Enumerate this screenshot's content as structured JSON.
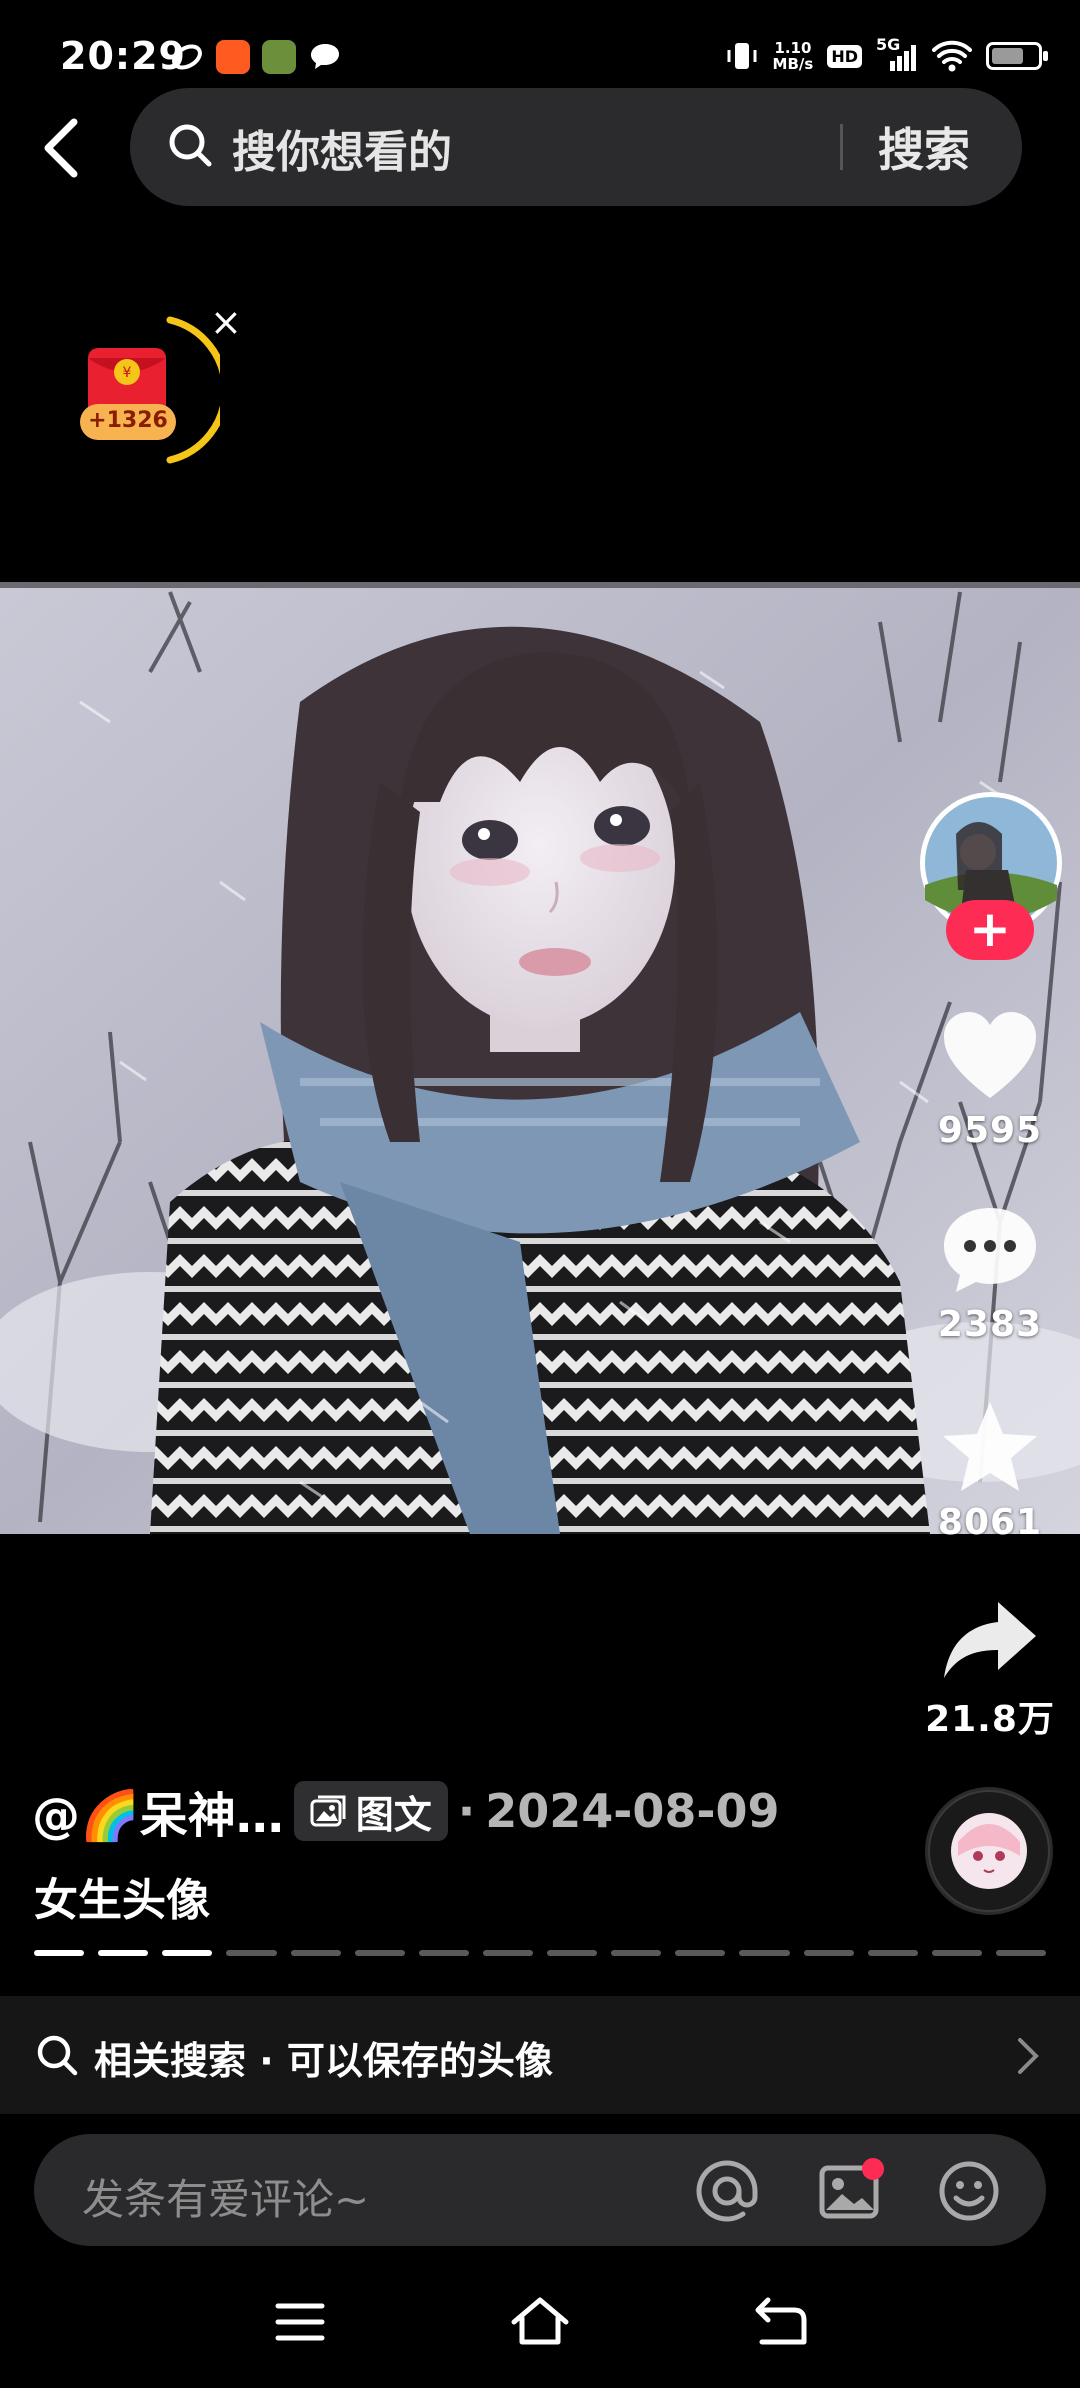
{
  "status_bar": {
    "time": "20:29",
    "net_speed_value": "1.10",
    "net_speed_unit": "MB/s",
    "hd": "HD",
    "signal": "5G",
    "battery_level": 0.7
  },
  "header": {
    "search_placeholder": "搜你想看的",
    "search_button": "搜索"
  },
  "red_packet": {
    "amount": "+1326",
    "close": "×"
  },
  "rail": {
    "likes": "9595",
    "comments": "2383",
    "favorites": "8061",
    "shares": "21.8万",
    "follow": "+"
  },
  "post": {
    "author": "@🌈呆神…",
    "type_chip": "图文",
    "date_prefix": "·",
    "date": "2024-08-09",
    "caption": "女生头像",
    "pages_total": 16,
    "pages_viewed": 3
  },
  "related": {
    "label": "相关搜索 · 可以保存的头像"
  },
  "comment": {
    "placeholder": "发条有爱评论~"
  },
  "colors": {
    "accent_red": "#fe2c55",
    "ring_yellow": "#f5c518",
    "background": "#000000"
  },
  "icons": [
    "back-arrow-icon",
    "search-icon",
    "heart-icon",
    "comment-icon",
    "star-icon",
    "share-icon",
    "at-icon",
    "image-icon",
    "emoji-icon",
    "menu-icon",
    "home-icon",
    "return-icon"
  ]
}
